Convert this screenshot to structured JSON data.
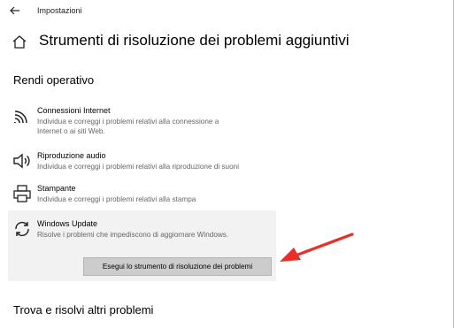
{
  "window": {
    "title": "Impostazioni"
  },
  "page": {
    "title": "Strumenti di risoluzione dei problemi aggiuntivi"
  },
  "sections": {
    "rendi_operativo": "Rendi operativo",
    "trova": "Trova e risolvi altri problemi"
  },
  "items": [
    {
      "icon": "wifi-icon",
      "name": "Connessioni Internet",
      "desc_line1": "Individua e correggi i problemi relativi alla connessione a",
      "desc_line2": "Internet o ai siti Web."
    },
    {
      "icon": "speaker-icon",
      "name": "Riproduzione audio",
      "desc_line1": "Individua e correggi i problemi relativi alla riproduzione di suoni"
    },
    {
      "icon": "printer-icon",
      "name": "Stampante",
      "desc_line1": "Individua e correggi i problemi relativi alla stampa"
    },
    {
      "icon": "refresh-icon",
      "name": "Windows Update",
      "desc_line1": "Risolve i problemi che impediscono di aggiornare Windows."
    }
  ],
  "run_button": {
    "label": "Esegui lo strumento di risoluzione dei problemi"
  },
  "colors": {
    "annotation_arrow": "#e8302a",
    "selected_panel": "#f2f2f2",
    "button": "#cccccc"
  }
}
